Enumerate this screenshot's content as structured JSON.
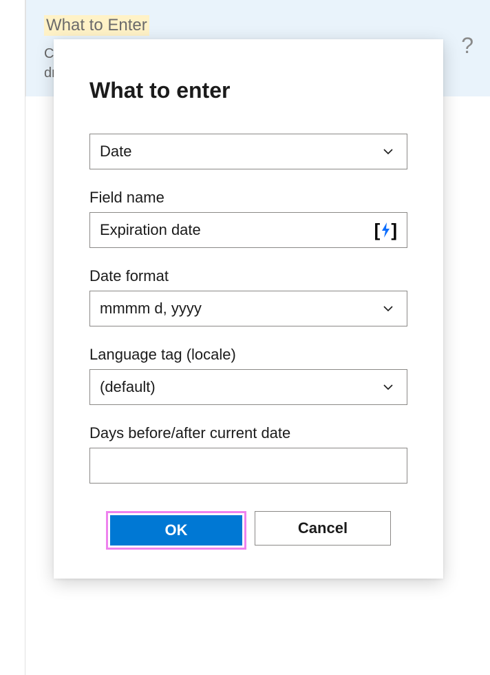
{
  "background": {
    "highlight": "What to Enter",
    "description_prefix": "Cr",
    "description_line2": "dr",
    "question": "?"
  },
  "modal": {
    "title": "What to enter",
    "typeSelect": {
      "value": "Date"
    },
    "fieldName": {
      "label": "Field name",
      "value": "Expiration date"
    },
    "dateFormat": {
      "label": "Date format",
      "value": "mmmm d, yyyy"
    },
    "languageTag": {
      "label": "Language tag (locale)",
      "value": "(default)"
    },
    "daysOffset": {
      "label": "Days before/after current date",
      "value": ""
    },
    "buttons": {
      "ok": "OK",
      "cancel": "Cancel"
    }
  }
}
